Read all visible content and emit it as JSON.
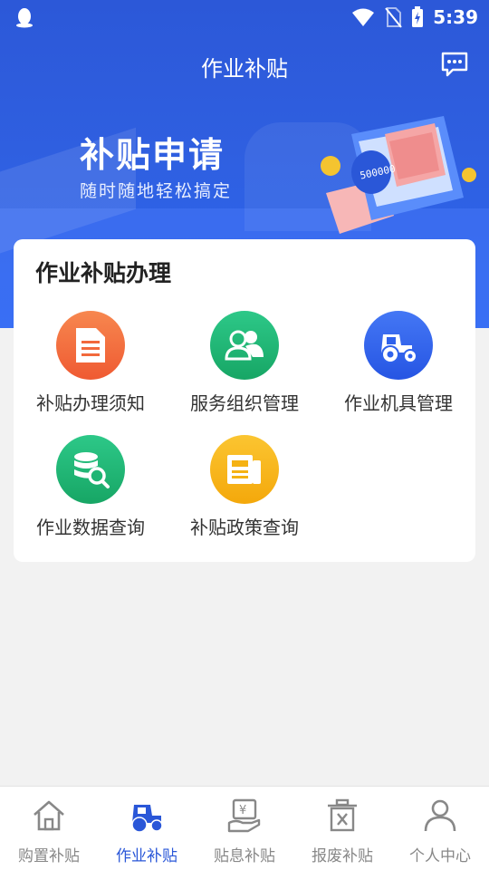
{
  "status": {
    "time": "5:39"
  },
  "header": {
    "title": "作业补贴"
  },
  "banner": {
    "title": "补贴申请",
    "subtitle": "随时随地轻松搞定",
    "machine_amount": "500000"
  },
  "card": {
    "title": "作业补贴办理",
    "items": [
      {
        "label": "补贴办理须知",
        "icon": "document-icon",
        "color": "#f2693c"
      },
      {
        "label": "服务组织管理",
        "icon": "people-icon",
        "color": "#20b574"
      },
      {
        "label": "作业机具管理",
        "icon": "tractor-icon",
        "color": "#2f62ec"
      },
      {
        "label": "作业数据查询",
        "icon": "database-search-icon",
        "color": "#20b574"
      },
      {
        "label": "补贴政策查询",
        "icon": "newspaper-icon",
        "color": "#f5b213"
      }
    ]
  },
  "tabs": [
    {
      "label": "购置补贴",
      "icon": "home-icon",
      "active": false
    },
    {
      "label": "作业补贴",
      "icon": "tractor-icon",
      "active": true
    },
    {
      "label": "贴息补贴",
      "icon": "yen-hand-icon",
      "active": false
    },
    {
      "label": "报废补贴",
      "icon": "trash-icon",
      "active": false
    },
    {
      "label": "个人中心",
      "icon": "user-icon",
      "active": false
    }
  ],
  "colors": {
    "primary": "#2a57d8",
    "tab_inactive": "#888888",
    "background": "#f2f2f2"
  }
}
